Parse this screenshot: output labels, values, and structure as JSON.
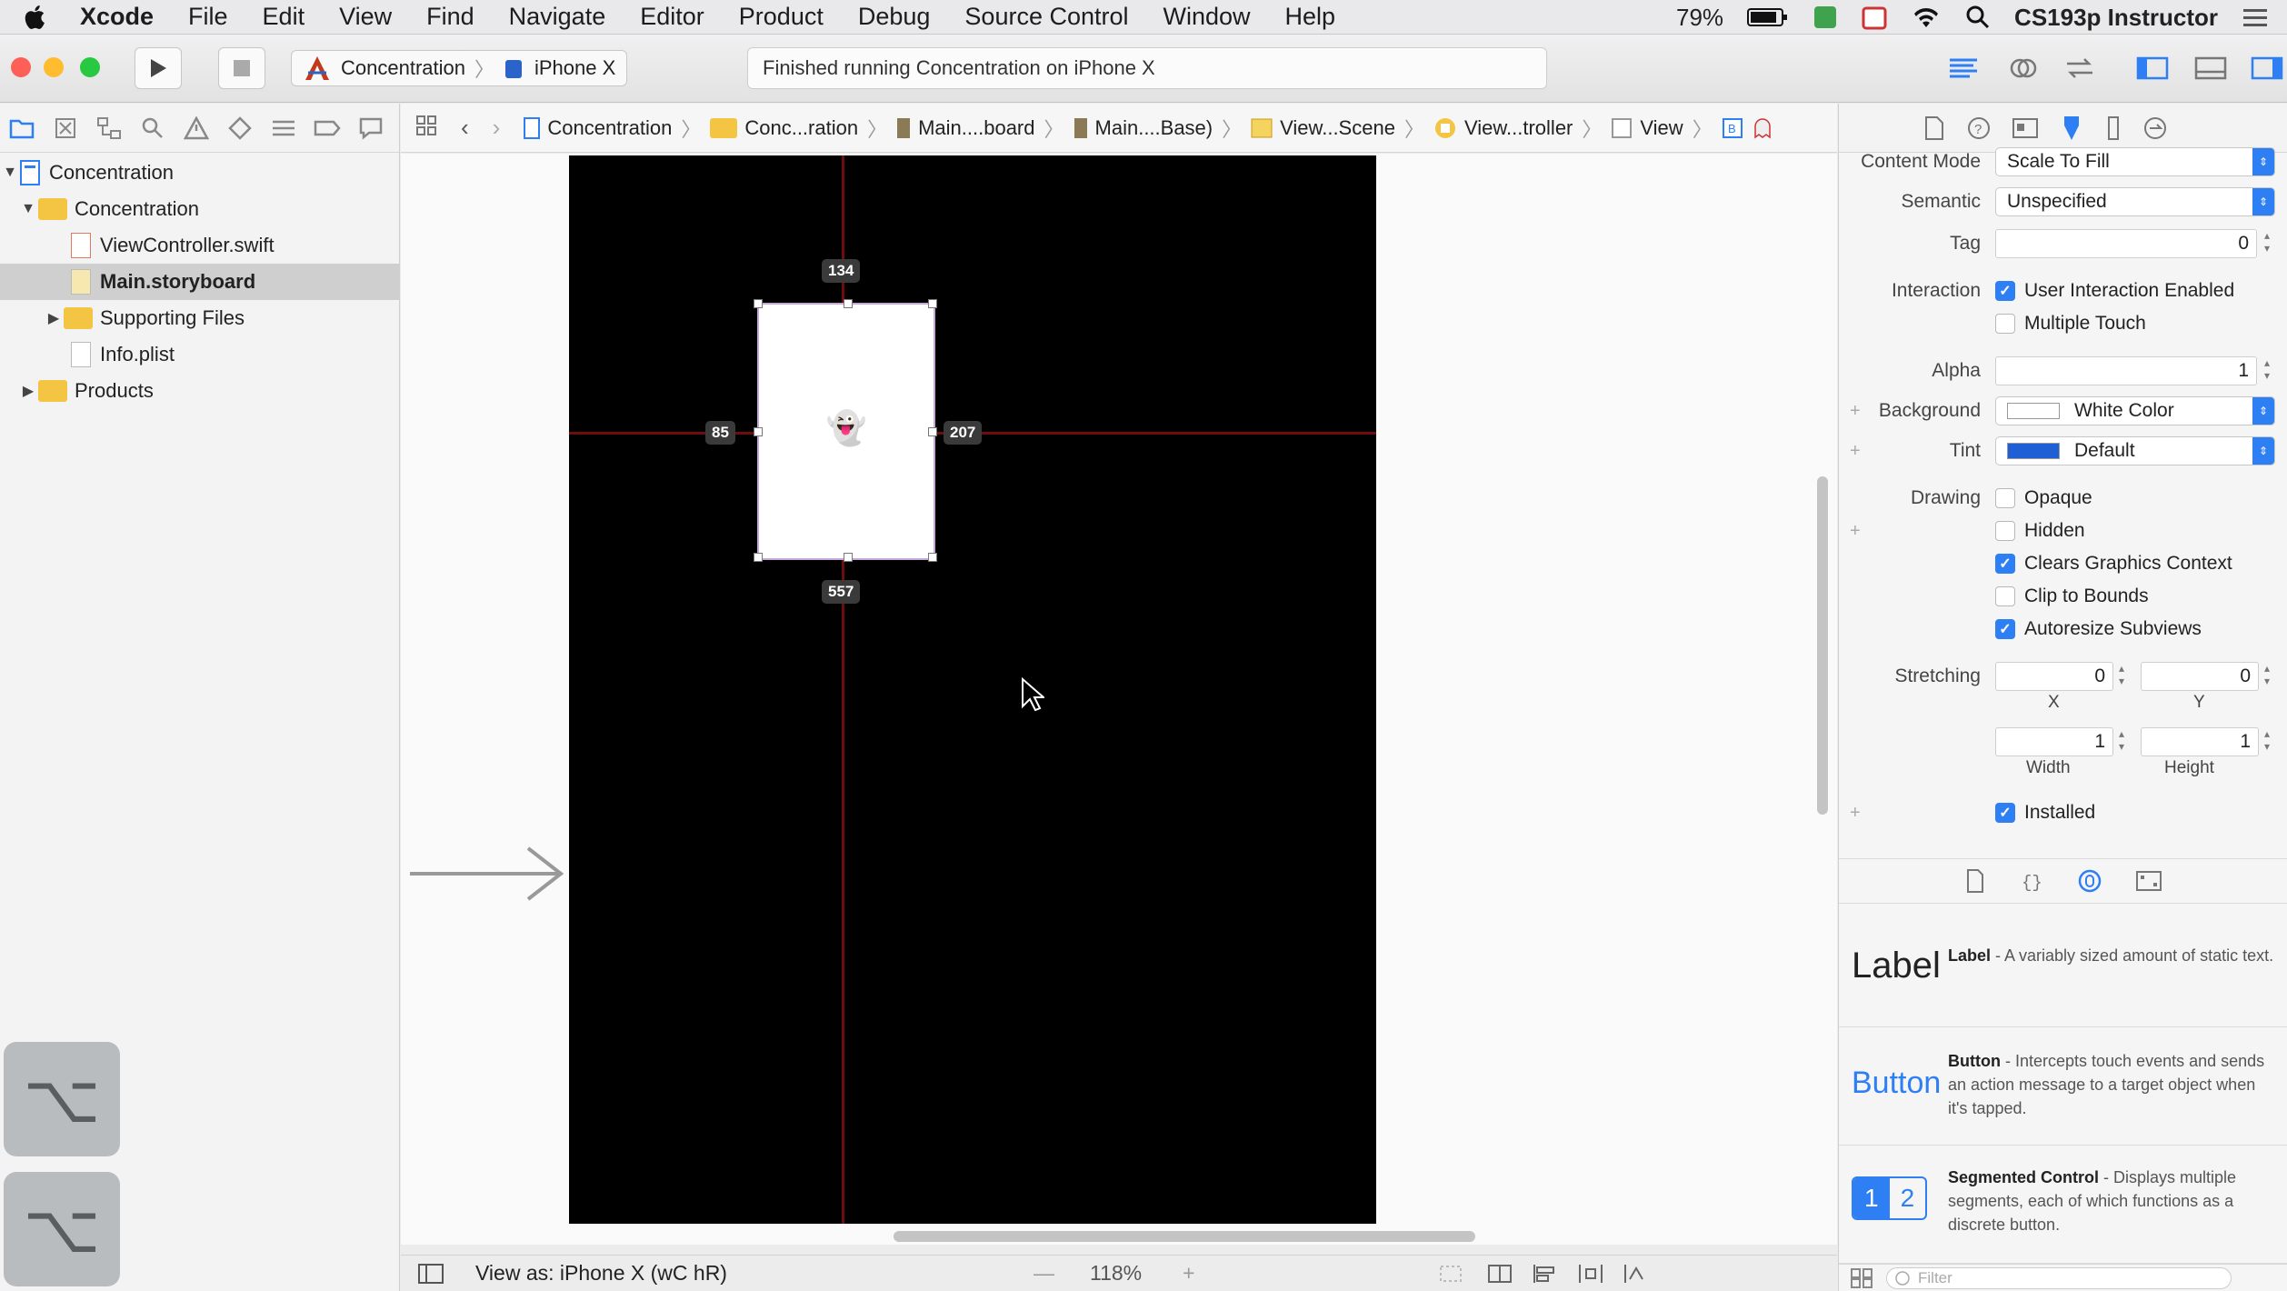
{
  "menubar": {
    "app": "Xcode",
    "items": [
      "File",
      "Edit",
      "View",
      "Find",
      "Navigate",
      "Editor",
      "Product",
      "Debug",
      "Source Control",
      "Window",
      "Help"
    ],
    "battery": "79%",
    "user": "CS193p Instructor"
  },
  "toolbar": {
    "scheme": "Concentration",
    "device": "iPhone X",
    "activity": "Finished running Concentration on iPhone X"
  },
  "navigator": {
    "rows": [
      {
        "label": "Concentration"
      },
      {
        "label": "Concentration"
      },
      {
        "label": "ViewController.swift"
      },
      {
        "label": "Main.storyboard"
      },
      {
        "label": "Supporting Files"
      },
      {
        "label": "Info.plist"
      },
      {
        "label": "Products"
      }
    ],
    "keycap_glyph": "⌥"
  },
  "jumpbar": {
    "crumbs": [
      "Concentration",
      "Conc...ration",
      "Main....board",
      "Main....Base)",
      "View...Scene",
      "View...troller",
      "View"
    ]
  },
  "canvas": {
    "card_emoji": "👻",
    "dim_top": "134",
    "dim_left": "85",
    "dim_right": "207",
    "dim_bottom": "557"
  },
  "bottombar": {
    "view_as": "View as: iPhone X (wC hR)",
    "zoom": "118%",
    "zoom_out": "—",
    "zoom_in": "+"
  },
  "inspector": {
    "content_mode": {
      "label": "Content Mode",
      "value": "Scale To Fill"
    },
    "semantic": {
      "label": "Semantic",
      "value": "Unspecified"
    },
    "tag": {
      "label": "Tag",
      "value": "0"
    },
    "interaction": {
      "label": "Interaction",
      "user_interaction": "User Interaction Enabled",
      "multiple_touch": "Multiple Touch"
    },
    "alpha": {
      "label": "Alpha",
      "value": "1"
    },
    "background": {
      "label": "Background",
      "value": "White Color",
      "color": "#ffffff"
    },
    "tint": {
      "label": "Tint",
      "value": "Default",
      "color": "#1f5fd6"
    },
    "drawing": {
      "label": "Drawing",
      "opaque": "Opaque",
      "hidden": "Hidden",
      "clears": "Clears Graphics Context",
      "clip": "Clip to Bounds",
      "autoresize": "Autoresize Subviews"
    },
    "stretching": {
      "label": "Stretching",
      "x": "0",
      "y": "0",
      "width": "1",
      "height": "1",
      "x_label": "X",
      "y_label": "Y",
      "width_label": "Width",
      "height_label": "Height"
    },
    "installed": "Installed"
  },
  "library": {
    "label": {
      "icon": "Label",
      "title": "Label",
      "desc": " - A variably sized amount of static text."
    },
    "button": {
      "icon": "Button",
      "title": "Button",
      "desc": " - Intercepts touch events and sends an action message to a target object when it's tapped."
    },
    "segmented": {
      "icon1": "1",
      "icon2": "2",
      "title": "Segmented Control",
      "desc": " - Displays multiple segments, each of which functions as a discrete button."
    },
    "filter_placeholder": "Filter"
  },
  "colors": {
    "accent": "#2f7ff4",
    "guide": "#6e0d0d"
  }
}
